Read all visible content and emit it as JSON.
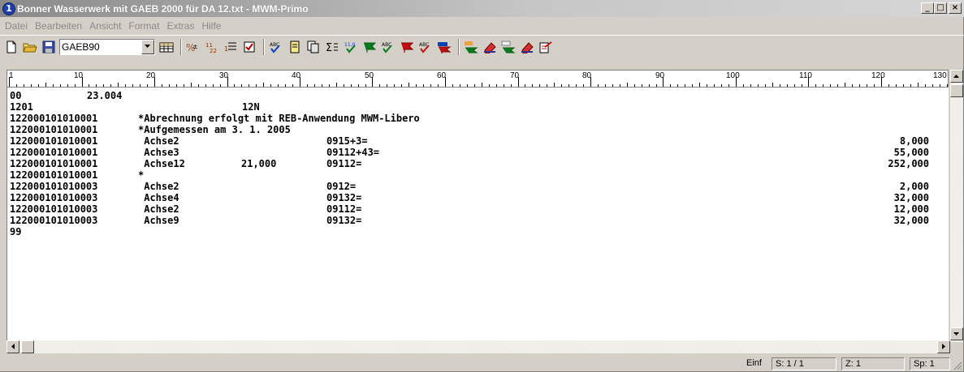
{
  "window": {
    "title": "Bonner Wasserwerk mit GAEB 2000 für DA 12.txt - MWM-Primo",
    "app_icon_glyph": "1",
    "minimize_glyph": "_",
    "maximize_glyph": "□",
    "close_glyph": "×"
  },
  "menu": [
    {
      "label": "Datei"
    },
    {
      "label": "Bearbeiten"
    },
    {
      "label": "Ansicht"
    },
    {
      "label": "Format"
    },
    {
      "label": "Extras"
    },
    {
      "label": "Hilfe"
    }
  ],
  "toolbar": {
    "format_select_value": "GAEB90",
    "icons": [
      "new-document-icon",
      "open-folder-icon",
      "save-disk-icon",
      "format-dropdown",
      "table-icon",
      "find-replace-icon",
      "number-format-icon",
      "list-icon",
      "check-icon",
      "spellcheck-icon",
      "page-icon",
      "copy-page-icon",
      "sum-icon",
      "reb-check-icon",
      "reb-flag-icon",
      "abc-flag-icon",
      "flag-red-icon",
      "abc-flag-2-icon",
      "flag-blue-icon",
      "text-edit-icon",
      "eraser-icon",
      "text-edit-2-icon",
      "eraser-2-icon",
      "export-icon"
    ]
  },
  "ruler": {
    "labels": [
      "1",
      "10",
      "20",
      "30",
      "40",
      "50",
      "60",
      "70",
      "80",
      "90",
      "100",
      "110",
      "120",
      "130"
    ]
  },
  "editor": {
    "lines": [
      {
        "c1": "00",
        "c2": "23.004",
        "c3": "",
        "c4": "",
        "c5": "",
        "c6": ""
      },
      {
        "c1": "1201",
        "c2": "",
        "c3": "12N",
        "c4": "",
        "c5": "",
        "c6": ""
      },
      {
        "c1": "122000101010001",
        "c2": "*Abrechnung erfolgt mit REB-Anwendung MWM-Libero",
        "c3": "",
        "c4": "",
        "c5": "",
        "c6": ""
      },
      {
        "c1": "122000101010001",
        "c2": "*Aufgemessen am 3. 1. 2005",
        "c3": "",
        "c4": "",
        "c5": "",
        "c6": ""
      },
      {
        "c1": "122000101010001",
        "c2": " Achse2",
        "c3": "",
        "c4": "",
        "c5": "0915+3=",
        "c6": "8,000"
      },
      {
        "c1": "122000101010001",
        "c2": " Achse3",
        "c3": "",
        "c4": "",
        "c5": "09112+43=",
        "c6": "55,000"
      },
      {
        "c1": "122000101010001",
        "c2": " Achse12",
        "c3": "",
        "c4": "21,000",
        "c5": "09112=",
        "c6": "252,000"
      },
      {
        "c1": "122000101010001",
        "c2": "*",
        "c3": "",
        "c4": "",
        "c5": "",
        "c6": ""
      },
      {
        "c1": "122000101010003",
        "c2": " Achse2",
        "c3": "",
        "c4": "",
        "c5": "0912=",
        "c6": "2,000"
      },
      {
        "c1": "122000101010003",
        "c2": " Achse4",
        "c3": "",
        "c4": "",
        "c5": "09132=",
        "c6": "32,000"
      },
      {
        "c1": "122000101010003",
        "c2": " Achse2",
        "c3": "",
        "c4": "",
        "c5": "09112=",
        "c6": "12,000"
      },
      {
        "c1": "122000101010003",
        "c2": " Achse9",
        "c3": "",
        "c4": "",
        "c5": "09132=",
        "c6": "32,000"
      },
      {
        "c1": "99",
        "c2": "",
        "c3": "",
        "c4": "",
        "c5": "",
        "c6": ""
      }
    ]
  },
  "statusbar": {
    "mode": "Einf",
    "page": "S: 1 / 1",
    "line": "Z: 1",
    "column": "Sp: 1"
  }
}
